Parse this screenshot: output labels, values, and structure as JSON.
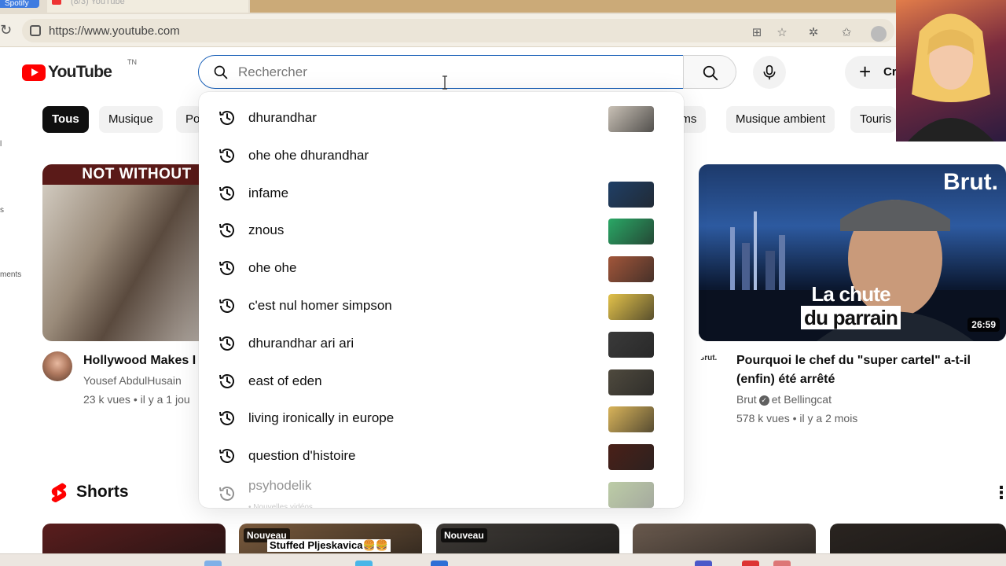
{
  "browser": {
    "tabs": [
      {
        "label": "Spotify"
      },
      {
        "label": "(8/3) YouTube"
      }
    ],
    "url": "https://www.youtube.com"
  },
  "header": {
    "logo_text": "YouTube",
    "logo_country": "TN",
    "search_placeholder": "Rechercher",
    "create_label": "Cr"
  },
  "sidebar_fragments": [
    "l",
    "s",
    "ments"
  ],
  "chips": [
    {
      "label": "Tous",
      "active": true
    },
    {
      "label": "Musique",
      "active": false
    },
    {
      "label": "Po",
      "active": false
    },
    {
      "label": "ums",
      "active": false
    },
    {
      "label": "Musique ambient",
      "active": false
    },
    {
      "label": "Touris",
      "active": false
    }
  ],
  "suggestions": [
    {
      "label": "dhurandhar",
      "icon": "history-icon",
      "thumb": true,
      "thumb_color": "#c9c1b6"
    },
    {
      "label": "ohe ohe dhurandhar",
      "icon": "history-icon",
      "thumb": false
    },
    {
      "label": "infame",
      "icon": "history-icon",
      "thumb": true,
      "thumb_color": "#1f3f66"
    },
    {
      "label": "znous",
      "icon": "history-icon",
      "thumb": true,
      "thumb_color": "#2aa866"
    },
    {
      "label": "ohe ohe",
      "icon": "history-icon",
      "thumb": true,
      "thumb_color": "#a2563a"
    },
    {
      "label": "c'est nul homer simpson",
      "icon": "history-icon",
      "thumb": true,
      "thumb_color": "#e3c24a"
    },
    {
      "label": "dhurandhar ari ari",
      "icon": "history-icon",
      "thumb": true,
      "thumb_color": "#3a3a3a"
    },
    {
      "label": "east of eden",
      "icon": "history-icon",
      "thumb": true,
      "thumb_color": "#4f4a3e"
    },
    {
      "label": "living ironically in europe",
      "icon": "history-icon",
      "thumb": true,
      "thumb_color": "#d9b45a"
    },
    {
      "label": "question d'histoire",
      "icon": "history-icon",
      "thumb": true,
      "thumb_color": "#4a2018"
    },
    {
      "label": "psyhodelik",
      "icon": "history-icon",
      "thumb": true,
      "thumb_color": "#6b8f3a",
      "sublabel": "• Nouvelles vidéos",
      "faded": true
    }
  ],
  "videos": [
    {
      "thumb_banner": "NOT WITHOUT",
      "title": "Hollywood Makes I",
      "channel": "Yousef AbdulHusain",
      "meta": "23 k vues • il y a 1 jou"
    },
    {
      "thumb_badge": "Brut.",
      "thumb_caption_1": "La chute",
      "thumb_caption_2": "du parrain",
      "duration": "26:59",
      "channel_avatar_text": "Brut.",
      "title": "Pourquoi le chef du \"super cartel\" a-t-il (enfin) été arrêté",
      "channel": "Brut",
      "channel_extra": "et Bellingcat",
      "meta": "578 k vues • il y a 2 mois"
    }
  ],
  "shorts": {
    "title": "Shorts",
    "items": [
      {
        "badge": "",
        "text": "",
        "color": "#5a1d1d"
      },
      {
        "badge": "Nouveau",
        "text": "Stuffed Pljeskavica🍔🍔",
        "color": "#7c5c3e"
      },
      {
        "badge": "Nouveau",
        "text": "",
        "color": "#3e3a36"
      },
      {
        "badge": "",
        "text": "",
        "color": "#6a5a4e"
      },
      {
        "badge": "",
        "text": "",
        "color": "#2a2420"
      }
    ]
  },
  "colors": {
    "yt_red": "#ff0000",
    "search_focus_border": "#1c62b9",
    "chip_bg": "#f2f2f2",
    "chip_active_bg": "#0f0f0f"
  }
}
